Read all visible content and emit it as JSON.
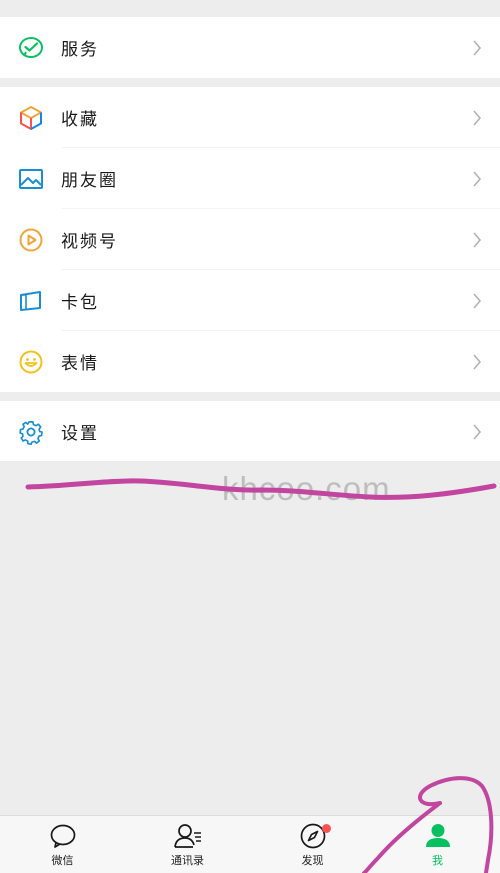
{
  "menu": {
    "groups": [
      {
        "items": [
          {
            "label": "服务",
            "icon": "wechat-pay-check-icon"
          }
        ]
      },
      {
        "items": [
          {
            "label": "收藏",
            "icon": "cube-icon"
          },
          {
            "label": "朋友圈",
            "icon": "image-icon"
          },
          {
            "label": "视频号",
            "icon": "play-circle-icon"
          },
          {
            "label": "卡包",
            "icon": "card-icon"
          },
          {
            "label": "表情",
            "icon": "smiley-icon"
          }
        ]
      },
      {
        "items": [
          {
            "label": "设置",
            "icon": "gear-icon"
          }
        ]
      }
    ]
  },
  "watermark": "khcoo.com",
  "tabbar": {
    "tabs": [
      {
        "label": "微信",
        "icon": "chat-bubble-icon"
      },
      {
        "label": "通讯录",
        "icon": "contacts-icon"
      },
      {
        "label": "发现",
        "icon": "compass-icon",
        "badge": "red-dot"
      },
      {
        "label": "我",
        "icon": "person-icon",
        "active": true
      }
    ]
  },
  "colors": {
    "accent": "#07c160",
    "background": "#ededed",
    "badge": "#fa5151",
    "annotation": "#c2459f"
  }
}
